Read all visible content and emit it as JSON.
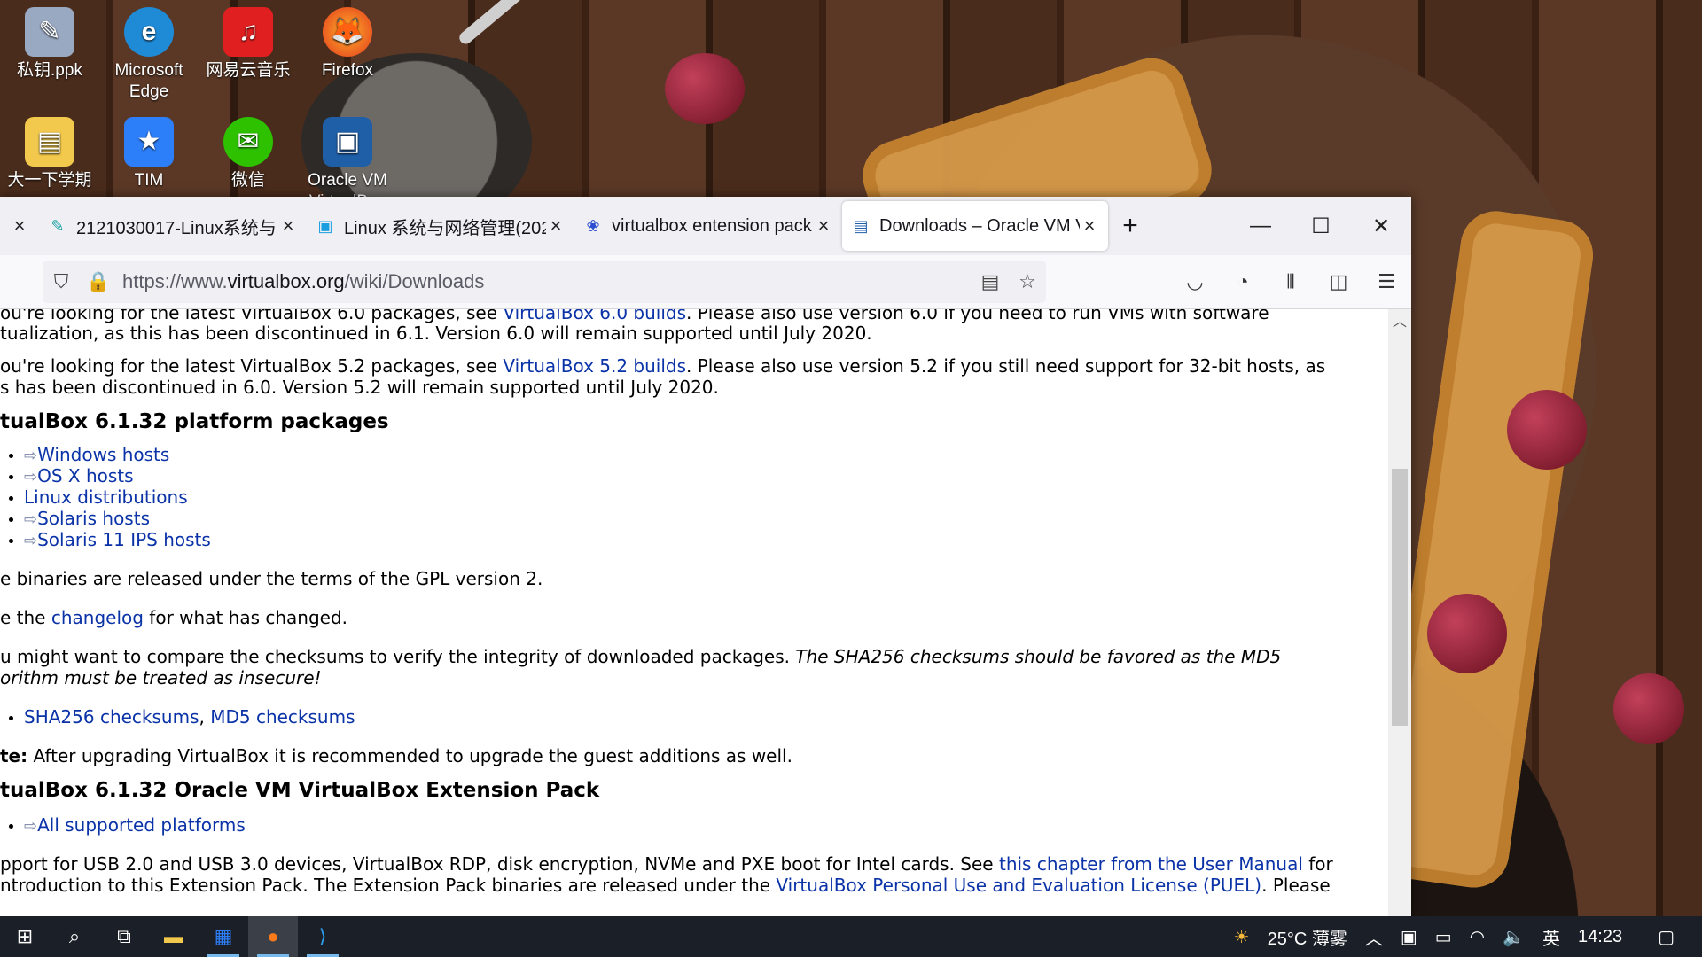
{
  "desktop": {
    "icons": [
      {
        "label": "私钥.ppk",
        "color": "#9aa9c2",
        "glyph": "✎"
      },
      {
        "label": "Microsoft Edge",
        "color": "#1f8ad6",
        "glyph": "e"
      },
      {
        "label": "网易云音乐",
        "color": "#e02020",
        "glyph": "♫"
      },
      {
        "label": "Firefox",
        "color": "#ff7a1a",
        "glyph": "🦊"
      },
      {
        "label": "大一下学期",
        "color": "#f2c94c",
        "glyph": "▤"
      },
      {
        "label": "TIM",
        "color": "#2d7ff9",
        "glyph": "★"
      },
      {
        "label": "微信",
        "color": "#2dc100",
        "glyph": "✉"
      },
      {
        "label": "Oracle VM VirtualBox",
        "color": "#1f5fa8",
        "glyph": "▣"
      }
    ]
  },
  "browser": {
    "tabs": [
      {
        "label": "2121030017-Linux系统与",
        "icon": "pen-icon",
        "icon_glyph": "✎",
        "icon_color": "#1aa3a3"
      },
      {
        "label": "Linux 系统与网络管理(202",
        "icon": "bilibili-icon",
        "icon_glyph": "▣",
        "icon_color": "#1a9ee0"
      },
      {
        "label": "virtualbox entension pack",
        "icon": "baidu-paw-icon",
        "icon_glyph": "❀",
        "icon_color": "#2a4ecf"
      },
      {
        "label": "Downloads – Oracle VM V",
        "icon": "virtualbox-icon",
        "icon_glyph": "▤",
        "icon_color": "#1f5fa8"
      }
    ],
    "new_tab": "+",
    "window_controls": {
      "minimize": "—",
      "maximize": "☐",
      "close": "✕"
    },
    "url": {
      "prefix": "https://www.",
      "host": "virtualbox.org",
      "path": "/wiki/Downloads"
    },
    "nav_icons": [
      "shield-icon",
      "lock-icon",
      "reader-icon",
      "star-icon",
      "pocket-icon",
      "sync-icon",
      "library-icon",
      "sidebar-icon",
      "menu-icon"
    ]
  },
  "page": {
    "p0_a": "ou're looking for the latest VirtualBox 6.0 packages, see ",
    "p0_link": "VirtualBox 6.0 builds",
    "p0_b": ". Please also use version 6.0 if you need to run VMs with software",
    "p0_line2": "tualization, as this has been discontinued in 6.1. Version 6.0 will remain supported until July 2020.",
    "p1_a": "ou're looking for the latest VirtualBox 5.2 packages, see ",
    "p1_link": "VirtualBox 5.2 builds",
    "p1_b": ". Please also use version 5.2 if you still need support for 32-bit hosts, as",
    "p1_line2": "s has been discontinued in 6.0. Version 5.2 will remain supported until July 2020.",
    "h_platform": "tualBox 6.1.32 platform packages",
    "platform_links": [
      "Windows hosts",
      "OS X hosts",
      "Linux distributions",
      "Solaris hosts",
      "Solaris 11 IPS hosts"
    ],
    "gpl": "e binaries are released under the terms of the GPL version 2.",
    "changelog_a": "e the ",
    "changelog_link": "changelog",
    "changelog_b": " for what has changed.",
    "checksum_a": "u might want to compare the checksums to verify the integrity of downloaded packages. ",
    "checksum_em": "The SHA256 checksums should be favored as the MD5",
    "checksum_line2": "orithm must be treated as insecure!",
    "sha_link": "SHA256 checksums",
    "md5_link": "MD5 checksums",
    "note_label": "te:",
    "note_text": " After upgrading VirtualBox it is recommended to upgrade the guest additions as well.",
    "h_ext": "tualBox 6.1.32 Oracle VM VirtualBox Extension Pack",
    "ext_link": "All supported platforms",
    "support_a": "pport for USB 2.0 and USB 3.0 devices, VirtualBox RDP, disk encryption, NVMe and PXE boot for Intel cards. See ",
    "support_link": "this chapter from the User Manual",
    "support_b": " for",
    "support_line2_a": "ntroduction to this Extension Pack. The Extension Pack binaries are released under the ",
    "support_line2_link": "VirtualBox Personal Use and Evaluation License (PUEL)",
    "support_line2_b": ". Please"
  },
  "taskbar": {
    "weather": "25°C 薄雾",
    "ime": "英",
    "time": "14:23"
  }
}
